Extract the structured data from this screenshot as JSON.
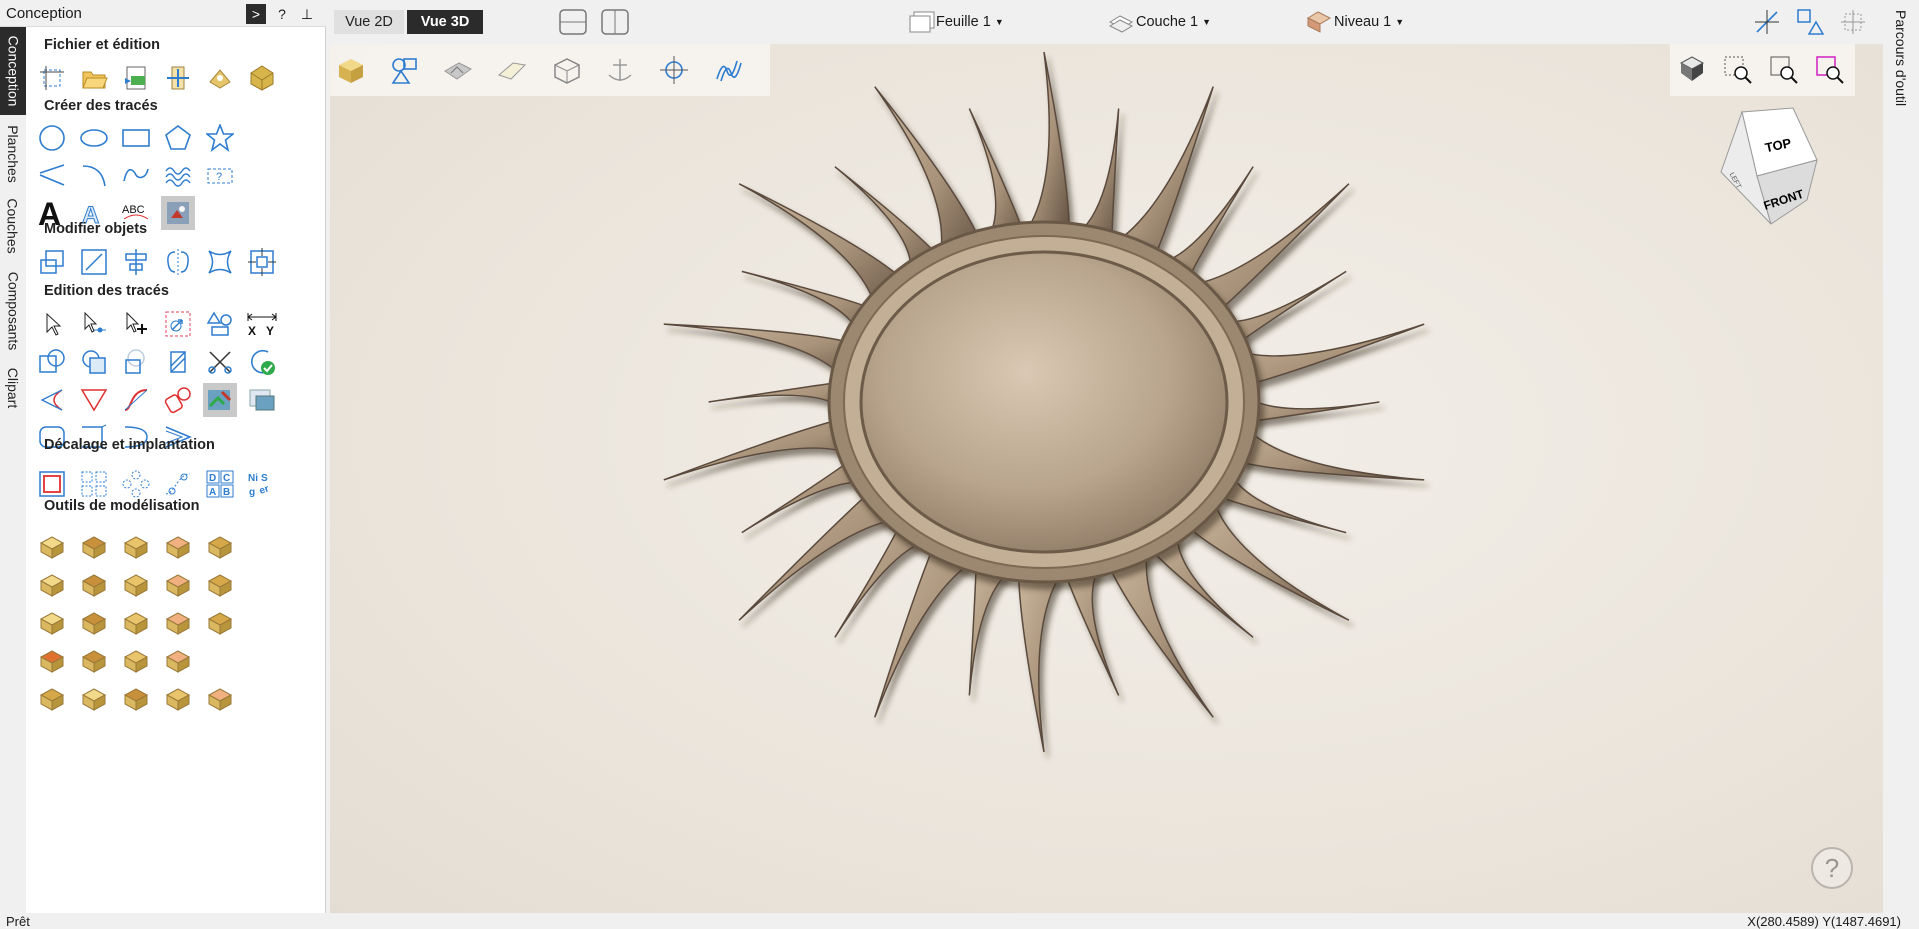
{
  "panel": {
    "title": "Conception",
    "vertical_tabs": [
      "Conception",
      "Planches",
      "Couches",
      "Composants",
      "Clipart"
    ],
    "sections": {
      "file": "Fichier et édition",
      "create": "Créer des tracés",
      "modify": "Modifier objets",
      "edit": "Edition des tracés",
      "offset": "Décalage et implantation",
      "model": "Outils de modélisation"
    },
    "header_buttons": {
      "run": ">",
      "help": "?",
      "pin": "⊥"
    }
  },
  "topbar": {
    "tab_2d": "Vue 2D",
    "tab_3d": "Vue 3D",
    "sheet": "Feuille 1",
    "layer": "Couche 1",
    "level": "Niveau 1"
  },
  "viewcube": {
    "top": "TOP",
    "front": "FRONT",
    "left": "LEFT"
  },
  "right_panel": {
    "label": "Parcours d'outil"
  },
  "status": {
    "left": "Prêt",
    "right": "X(280.4589) Y(1487.4691)"
  },
  "help": "?",
  "colors": {
    "accent_blue": "#2e7ccf",
    "active_tab": "#2b2b2b",
    "relief": "#a8957e",
    "viewport_bg": "#ece6dd"
  },
  "icons": {
    "file": [
      "new-job-icon",
      "open-icon",
      "save-icon",
      "import-icon",
      "export-icon",
      "model-icon"
    ],
    "create": [
      "circle-icon",
      "ellipse-icon",
      "rectangle-icon",
      "polygon-icon",
      "star-icon",
      "polyline-icon",
      "arc-icon",
      "curve-icon",
      "wave-icon",
      "texture-icon",
      "text-icon",
      "text-outline-icon",
      "text-on-curve-icon",
      "bitmap-trace-icon"
    ],
    "modify": [
      "move-icon",
      "scale-icon",
      "align-icon",
      "mirror-icon",
      "distort-icon",
      "anchor-icon"
    ],
    "edit": [
      "select-icon",
      "node-edit-icon",
      "node-add-icon",
      "transform-icon",
      "group-icon",
      "measure-icon",
      "weld-icon",
      "subtract-icon",
      "intersect-icon",
      "trim-icon",
      "scissors-icon",
      "close-vector-icon",
      "fillet-icon",
      "chamfer-icon",
      "smooth-icon",
      "fit-curve-icon",
      "image-trace-icon",
      "image-icon",
      "rounded-rect-icon",
      "extend-icon",
      "join-icon",
      "offset-corner-icon"
    ],
    "offset": [
      "offset-icon",
      "array-icon",
      "circular-array-icon",
      "path-array-icon",
      "nesting-icon",
      "text-nesting-icon"
    ],
    "model": [
      "plane-icon",
      "dome-icon",
      "pyramid-icon",
      "cone-icon",
      "extrude-icon",
      "sweep-icon",
      "rotate-icon",
      "spin-icon",
      "loft-icon",
      "sculpt-icon",
      "texture-relief-icon",
      "slice-icon",
      "cut-relief-icon",
      "stack-icon",
      "coin-icon",
      "box-red-icon",
      "tilt-icon",
      "flame-icon",
      "fade-icon",
      "layer-icon",
      "split-icon",
      "bake-icon",
      "combine-icon",
      "clear-icon"
    ]
  }
}
